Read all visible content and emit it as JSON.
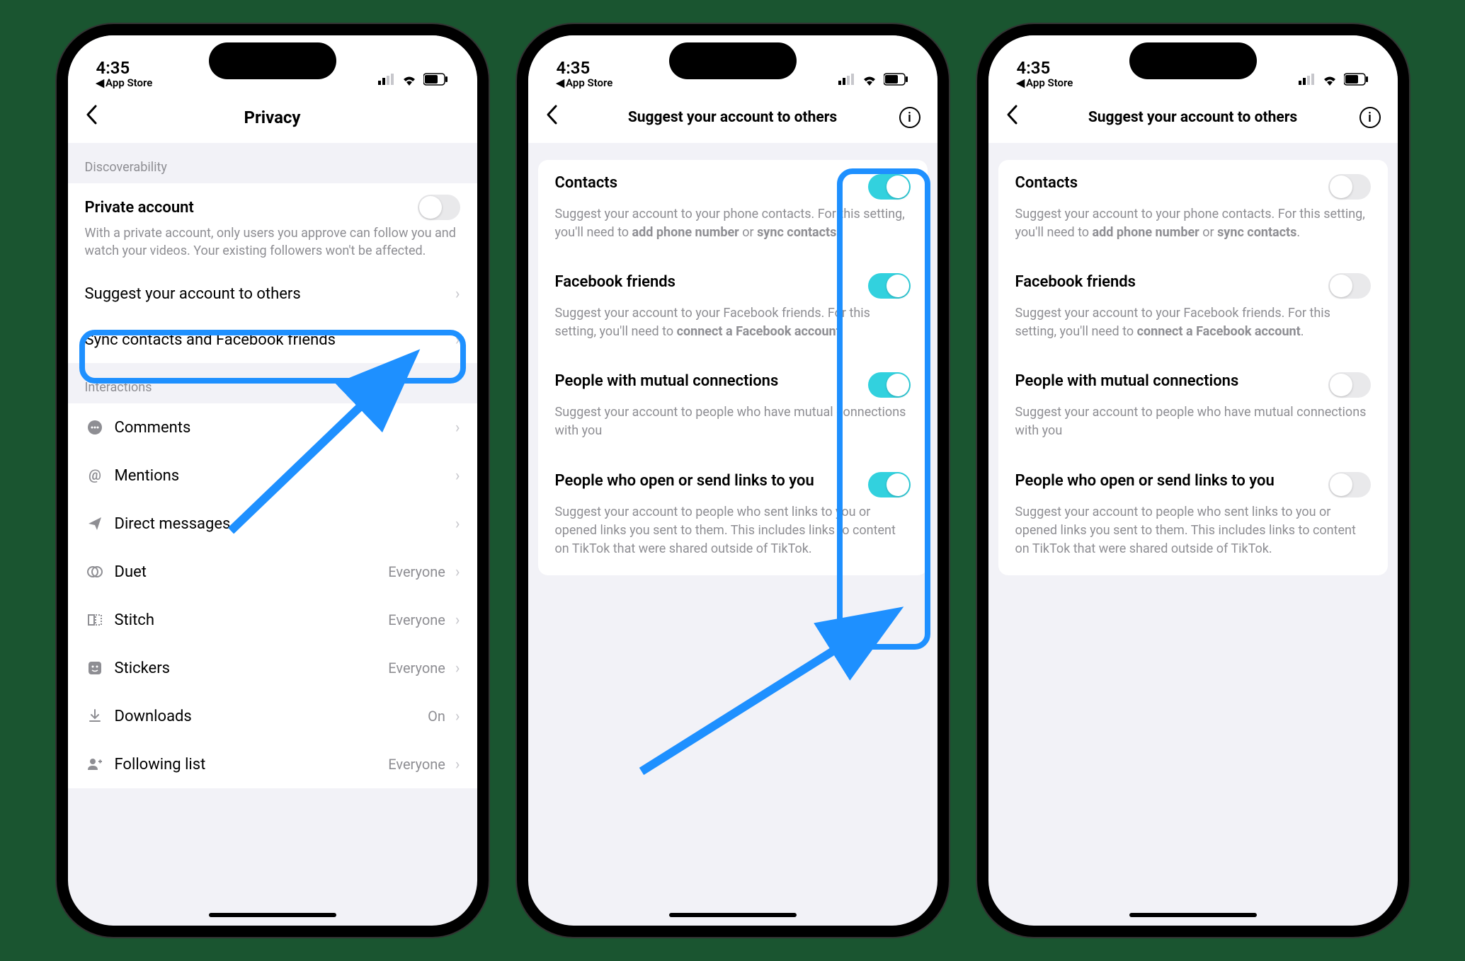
{
  "status": {
    "time": "4:35",
    "back_app": "App Store"
  },
  "screen1": {
    "title": "Privacy",
    "section_discoverability": "Discoverability",
    "private_account": {
      "label": "Private account",
      "desc": "With a private account, only users you approve can follow you and watch your videos. Your existing followers won't be affected."
    },
    "suggest_label": "Suggest your account to others",
    "sync_label": "Sync contacts and Facebook friends",
    "section_interactions": "Interactions",
    "items": [
      {
        "label": "Comments",
        "value": ""
      },
      {
        "label": "Mentions",
        "value": ""
      },
      {
        "label": "Direct messages",
        "value": ""
      },
      {
        "label": "Duet",
        "value": "Everyone"
      },
      {
        "label": "Stitch",
        "value": "Everyone"
      },
      {
        "label": "Stickers",
        "value": "Everyone"
      },
      {
        "label": "Downloads",
        "value": "On"
      },
      {
        "label": "Following list",
        "value": "Everyone"
      }
    ]
  },
  "screen2": {
    "title": "Suggest your account to others",
    "settings": [
      {
        "title": "Contacts",
        "desc_pre": "Suggest your account to your phone contacts. For this setting, you'll need to ",
        "desc_bold1": "add phone number",
        "desc_mid": " or ",
        "desc_bold2": "sync contacts",
        "desc_post": "."
      },
      {
        "title": "Facebook friends",
        "desc_pre": "Suggest your account to your Facebook friends. For this setting, you'll need to ",
        "desc_bold1": "connect a Facebook account",
        "desc_mid": "",
        "desc_bold2": "",
        "desc_post": "."
      },
      {
        "title": "People with mutual connections",
        "desc_pre": "Suggest your account to people who have mutual connections with you",
        "desc_bold1": "",
        "desc_mid": "",
        "desc_bold2": "",
        "desc_post": ""
      },
      {
        "title": "People who open or send links to you",
        "desc_pre": "Suggest your account to people who sent links to you or opened links you sent to them. This includes links to content on TikTok that were shared outside of TikTok.",
        "desc_bold1": "",
        "desc_mid": "",
        "desc_bold2": "",
        "desc_post": ""
      }
    ],
    "toggles_on": [
      true,
      true,
      true,
      true
    ],
    "toggles_off": [
      false,
      false,
      false,
      false
    ]
  }
}
